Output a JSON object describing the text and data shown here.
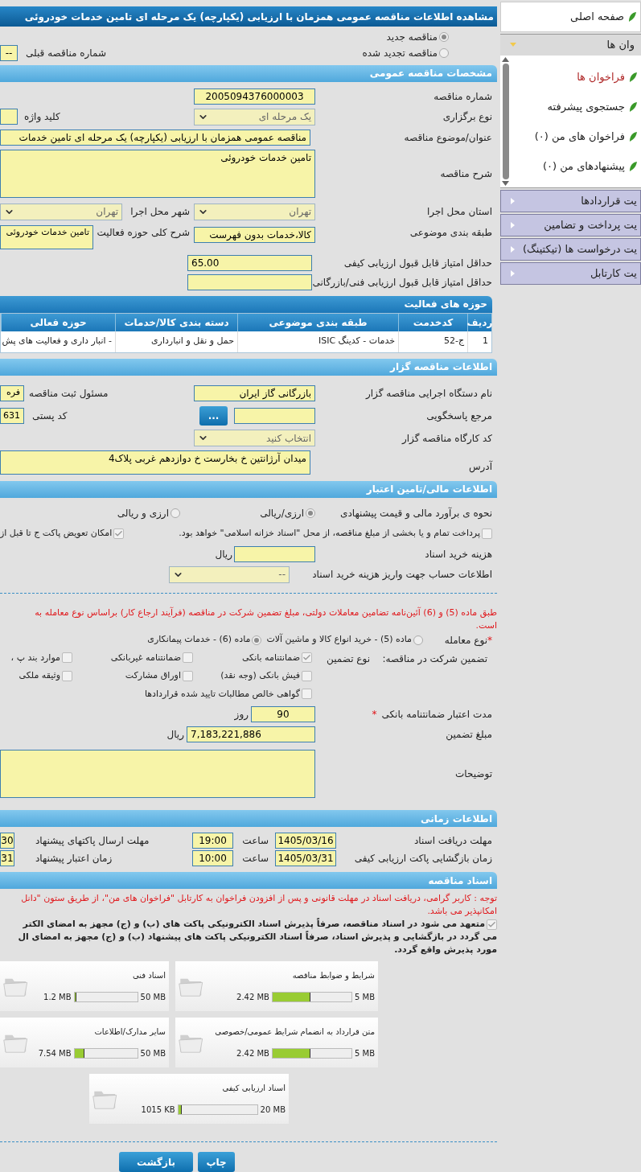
{
  "sidebar": {
    "home": "صفحه اصلی",
    "group": {
      "label": "وان ها",
      "expanded": true
    },
    "items": [
      {
        "label": "فراخوان ها",
        "selected": true
      },
      {
        "label": "جستجوی پیشرفته",
        "selected": false
      },
      {
        "label": "فراخوان های من (۰)",
        "selected": false
      },
      {
        "label": "پیشنهادهای من (۰)",
        "selected": false
      }
    ],
    "sections": [
      "یت قراردادها",
      "یت پرداخت و تضامین",
      "یت درخواست ها (تیکتینگ)",
      "یت کارتابل"
    ]
  },
  "page_title": "مشاهده اطلاعات مناقصه عمومی همزمان با ارزیابی (یکپارچه) یک مرحله ای تامین خدمات خودروئی",
  "tender_status": {
    "options": [
      {
        "label": "مناقصه جدید",
        "selected": true
      },
      {
        "label": "مناقصه تجدید شده",
        "selected": false
      }
    ],
    "previous_number_label": "شماره مناقصه قبلی",
    "previous_number": "--"
  },
  "general": {
    "heading": "مشخصات مناقصه عمومی",
    "number": {
      "label": "شماره مناقصه",
      "value": "2005094376000003"
    },
    "holding_type": {
      "label": "نوع برگزاری",
      "value": "یک مرحله ای"
    },
    "keyword": {
      "label": "کلید واژه"
    },
    "subject": {
      "label": "عنوان/موضوع مناقصه",
      "value": "مناقصه عمومی همزمان با ارزیابی (یکپارچه) یک مرحله ای تامین خدمات"
    },
    "description": {
      "label": "شرح مناقصه",
      "value": "تامین خدمات خودروئی"
    },
    "province": {
      "label": "استان محل اجرا",
      "value": "تهران"
    },
    "city": {
      "label": "شهر محل اجرا",
      "value": "تهران"
    },
    "classification": {
      "label": "طبقه بندی موضوعی",
      "value": "کالا،خدمات بدون فهرست"
    },
    "activity": {
      "label": "شرح کلی حوزه فعالیت",
      "value": "تامین خدمات خودروئی"
    },
    "min_quality_score": {
      "label": "حداقل امتیاز قابل قبول ارزیابی کیفی",
      "value": "65.00"
    },
    "min_technical_score": {
      "label": "حداقل امتیاز قابل قبول ارزیابی فنی/بازرگانی"
    }
  },
  "activities": {
    "heading": "حوزه های فعالیت",
    "columns": [
      "ردیف",
      "کدخدمت",
      "طبقه بندی موضوعی",
      "دسته بندی کالا/خدمات",
      "حوزه فعالی"
    ],
    "rows": [
      [
        "1",
        "ج-52",
        "خدمات - کدینگ ISIC",
        "حمل و نقل و انبارداری",
        "- انبار داری و فعالیت های پش"
      ]
    ]
  },
  "organizer": {
    "heading": "اطلاعات مناقصه گزار",
    "agency": {
      "label": "نام دستگاه اجرایی مناقصه گزار",
      "value": "بازرگانی گاز ایران"
    },
    "registrar": {
      "label": "مسئول ثبت مناقصه",
      "value": "فره"
    },
    "reference": {
      "label": "مرجع پاسخگویی",
      "button": "..."
    },
    "postal_code": {
      "label": "کد پستی",
      "value": "631"
    },
    "workshop": {
      "label": "کد کارگاه مناقصه گزار",
      "value": "انتخاب کنید"
    },
    "address": {
      "label": "آدرس",
      "value": "میدان آرژانتین خ بخارست خ دوازدهم غربی پلاک4"
    }
  },
  "finance": {
    "heading": "اطلاعات مالی/تامین اعتبار",
    "estimate": {
      "label": "نحوه ی برآورد مالی و قیمت پیشنهادی",
      "options": [
        {
          "label": "ارزی/ریالی",
          "selected": true
        },
        {
          "label": "ارزی و ریالی",
          "selected": false
        }
      ]
    },
    "checks": [
      {
        "label": "پرداخت تمام و یا بخشی از مبلغ مناقصه، از محل \"اسناد خزانه اسلامی\" خواهد بود.",
        "checked": false
      },
      {
        "label": "امکان تعویض پاکت ج تا قبل از",
        "checked": true
      }
    ],
    "document_fee": {
      "label": "هزینه خرید اسناد",
      "unit": "ریال"
    },
    "fee_account": {
      "label": "اطلاعات حساب جهت واریز هزینه خرید اسناد",
      "value": "--"
    }
  },
  "guarantee": {
    "notice": [
      "طبق ماده (5) و (6) آئین‌نامه تضامین معاملات دولتی، مبلغ تضمین شرکت در مناقصه (فرآیند ارجاع کار) براساس نوع معامله به",
      "است."
    ],
    "deal_type": {
      "mark": "*",
      "label": "نوع معامله",
      "options": [
        {
          "label": "ماده (5) - خرید انواع کالا و ماشین آلات",
          "selected": false
        },
        {
          "label": "ماده (6) - خدمات پیمانکاری",
          "selected": true
        }
      ]
    },
    "participation_label": "تضمین شرکت در مناقصه:",
    "type_label": "نوع تضمین",
    "types": [
      {
        "label": "ضمانتنامه بانکی",
        "checked": true
      },
      {
        "label": "ضمانتنامه غیربانکی",
        "checked": false
      },
      {
        "label": "موارد بند پ ،",
        "checked": false
      },
      {
        "label": "فیش بانکی (وجه نقد)",
        "checked": false
      },
      {
        "label": "اوراق مشارکت",
        "checked": false
      },
      {
        "label": "وثیقه ملکی",
        "checked": false
      },
      {
        "label": "گواهی خالص مطالبات تایید شده قراردادها",
        "checked": false
      }
    ],
    "validity": {
      "label": "مدت اعتبار ضمانتنامه بانکی",
      "mark": "*",
      "value": "90",
      "unit": "روز"
    },
    "amount": {
      "label": "مبلغ تضمین",
      "value": "7,183,221,886",
      "unit": "ریال"
    },
    "notes": {
      "label": "توضیحات"
    }
  },
  "schedule": {
    "heading": "اطلاعات زمانی",
    "rows": [
      {
        "label": "مهلت دریافت اسناد",
        "date": "1405/03/16",
        "time_label": "ساعت",
        "time": "19:00",
        "other_label": "مهلت ارسال پاکتهای پیشنهاد",
        "other_value": "30"
      },
      {
        "label": "زمان بازگشایی پاکت ارزیابی کیفی",
        "date": "1405/03/31",
        "time_label": "ساعت",
        "time": "10:00",
        "other_label": "زمان اعتبار پیشنهاد",
        "other_value": "31"
      }
    ]
  },
  "documents": {
    "heading": "اسناد مناقصه",
    "notice": [
      "توجه : کاربر گرامی، دریافت اسناد در مهلت قانونی و پس از افزودن فراخوان به کارتابل \"فراخوان های من\"، از طریق ستون \"دانل",
      "امکانپذیر می باشد."
    ],
    "commitment": {
      "checked": true,
      "lines": [
        "متعهد می شود در اسناد مناقصه، صرفاً پذیرش اسناد الکترونیکی پاکت های (ب) و (ج) مجهز به امضای الکتر",
        "می گردد در بازگشایی و پذیرش اسناد، صرفاً اسناد الکترونیکی پاکت های پیشنهاد (ب) و (ج) مجهز به امضای ال",
        "مورد پذیرش واقع گردد."
      ]
    },
    "files": [
      {
        "name": "شرایط و ضوابط مناقصه",
        "max": "5 MB",
        "size": "2.42 MB",
        "level": 0.48
      },
      {
        "name": "اسناد فنی",
        "max": "50 MB",
        "size": "1.2 MB",
        "level": 0.03
      },
      {
        "name": "متن قرارداد به انضمام شرایط عمومی/خصوصی",
        "max": "5 MB",
        "size": "2.42 MB",
        "level": 0.48
      },
      {
        "name": "سایر مدارک/اطلاعات",
        "max": "50 MB",
        "size": "7.54 MB",
        "level": 0.16
      },
      {
        "name": "اسناد ارزیابی کیفی",
        "max": "20 MB",
        "size": "1015 KB",
        "level": 0.05
      }
    ]
  },
  "buttons": [
    "چاپ",
    "بازگشت"
  ]
}
